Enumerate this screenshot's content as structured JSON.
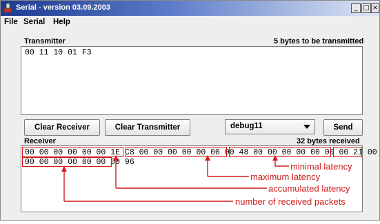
{
  "window": {
    "title": "Serial - version 03.09.2003",
    "controls": {
      "minimize": "_",
      "maximize": "□",
      "close": "×"
    }
  },
  "menu": [
    "File",
    "Serial",
    "Help"
  ],
  "transmitter": {
    "label": "Transmitter",
    "status": "5 bytes to be transmitted",
    "text": "00 11 10 01 F3"
  },
  "buttons": {
    "clear_receiver": "Clear Receiver",
    "clear_transmitter": "Clear Transmitter",
    "send": "Send"
  },
  "combo": {
    "selected": "debug11"
  },
  "receiver": {
    "label": "Receiver",
    "status": "32 bytes received",
    "line1": "00 00 00 00 00 00 1E C8 00 00 00 00 00 00 00 48 00 00 00 00 00 00 00 21 00",
    "line2": "00 00 00 00 00 00 00 96"
  },
  "annotations": {
    "minimal": "minimal latency",
    "maximum": "maximum latency",
    "accumulated": "accumulated latency",
    "packets": "number of received packets"
  },
  "colors": {
    "annotation": "#d11a1a",
    "titlebar_start": "#1c3a8f",
    "titlebar_end": "#dfe6f5"
  },
  "icons": [
    "app-icon",
    "minimize-icon",
    "maximize-icon",
    "close-icon",
    "dropdown-arrow-icon"
  ]
}
